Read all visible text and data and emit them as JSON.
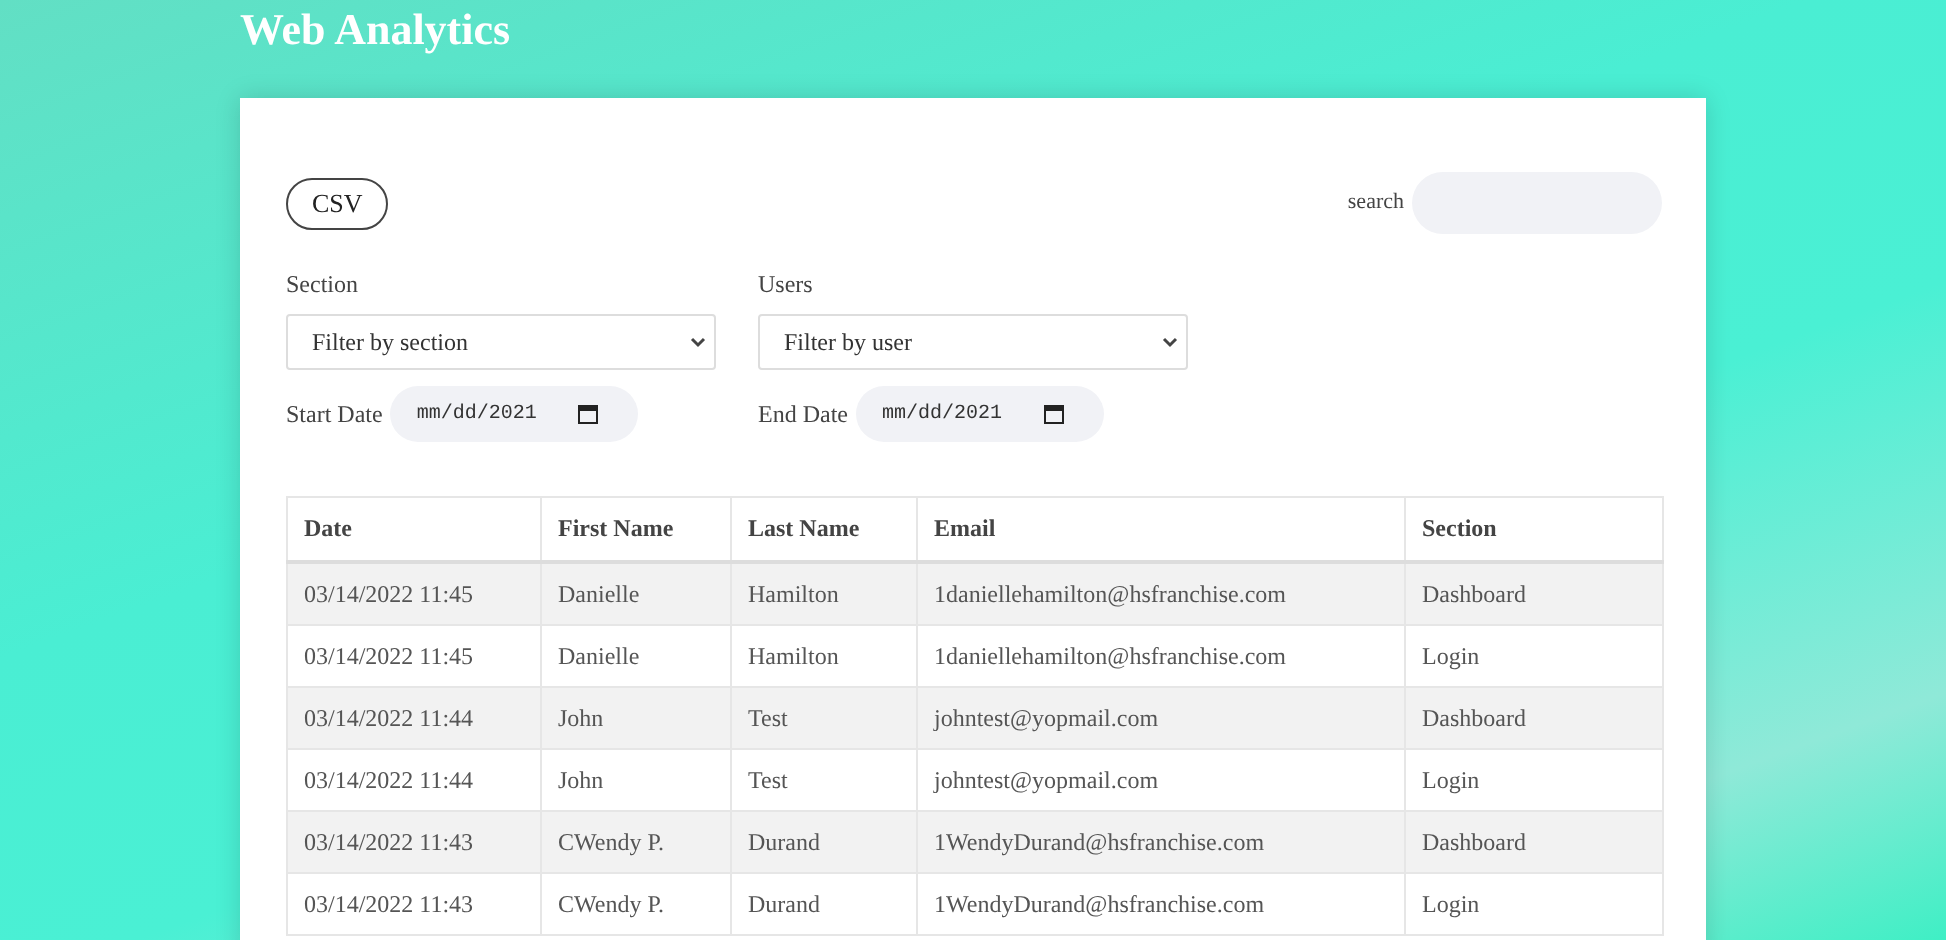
{
  "header": {
    "title": "Web Analytics"
  },
  "toolbar": {
    "csv_button": "CSV",
    "search": {
      "label": "search"
    }
  },
  "filters": {
    "section": {
      "label": "Section",
      "value": "Filter by section"
    },
    "users": {
      "label": "Users",
      "value": "Filter by user"
    },
    "start_date": {
      "label": "Start Date",
      "value": "mm/dd/2021"
    },
    "end_date": {
      "label": "End Date",
      "value": "mm/dd/2021"
    }
  },
  "table": {
    "columns": [
      "Date",
      "First Name",
      "Last Name",
      "Email",
      "Section"
    ],
    "rows": [
      [
        "03/14/2022 11:45",
        "Danielle",
        "Hamilton",
        "1daniellehamilton@hsfranchise.com",
        "Dashboard"
      ],
      [
        "03/14/2022 11:45",
        "Danielle",
        "Hamilton",
        "1daniellehamilton@hsfranchise.com",
        "Login"
      ],
      [
        "03/14/2022 11:44",
        "John",
        "Test",
        "johntest@yopmail.com",
        "Dashboard"
      ],
      [
        "03/14/2022 11:44",
        "John",
        "Test",
        "johntest@yopmail.com",
        "Login"
      ],
      [
        "03/14/2022 11:43",
        "CWendy P.",
        "Durand",
        "1WendyDurand@hsfranchise.com",
        "Dashboard"
      ],
      [
        "03/14/2022 11:43",
        "CWendy P.",
        "Durand",
        "1WendyDurand@hsfranchise.com",
        "Login"
      ]
    ]
  }
}
